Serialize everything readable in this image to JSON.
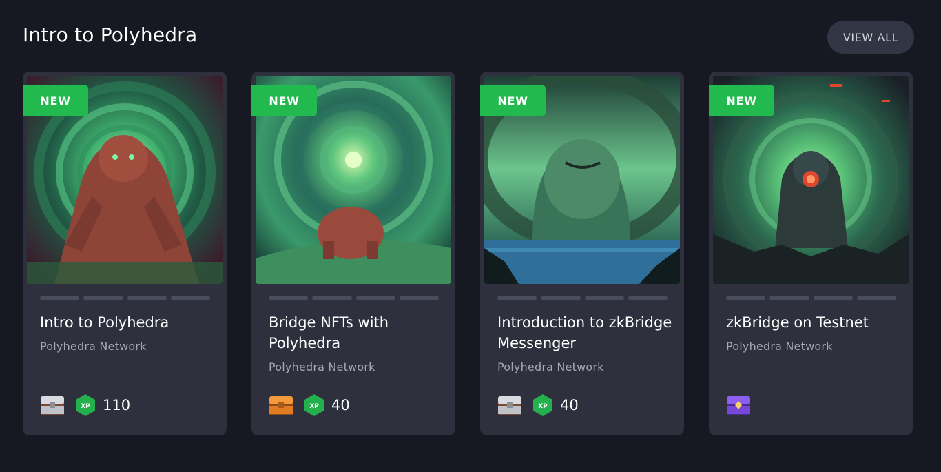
{
  "section": {
    "title": "Intro to Polyhedra",
    "view_all_label": "VIEW ALL"
  },
  "cards": [
    {
      "badge": "NEW",
      "title": "Intro to Polyhedra",
      "subtitle": "Polyhedra Network",
      "chest_icon": "silver-chest-icon",
      "xp_label": "XP",
      "xp": "110"
    },
    {
      "badge": "NEW",
      "title": "Bridge NFTs with Polyhedra",
      "subtitle": "Polyhedra Network",
      "chest_icon": "orange-chest-icon",
      "xp_label": "XP",
      "xp": "40"
    },
    {
      "badge": "NEW",
      "title": "Introduction to zkBridge Messenger",
      "subtitle": "Polyhedra Network",
      "chest_icon": "silver-chest-icon",
      "xp_label": "XP",
      "xp": "40"
    },
    {
      "badge": "NEW",
      "title": "zkBridge on Testnet",
      "subtitle": "Polyhedra Network",
      "chest_icon": "purple-chest-icon"
    }
  ],
  "colors": {
    "background": "#161822",
    "card": "#2e313d",
    "badge_green": "#22b94e",
    "subtitle": "#a6a9b4"
  }
}
